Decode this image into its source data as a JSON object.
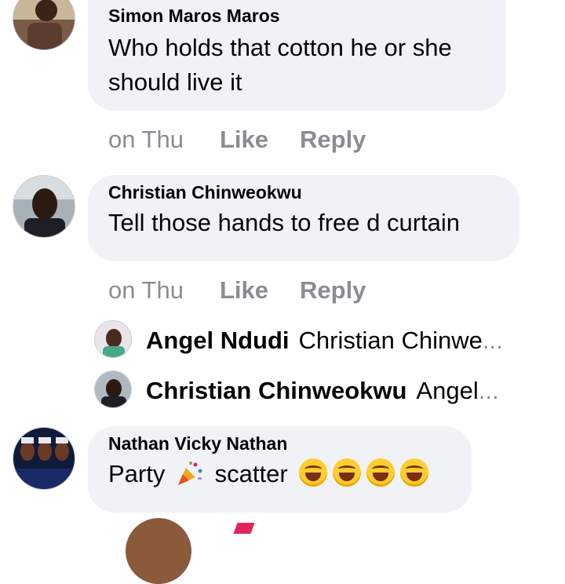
{
  "comments": [
    {
      "author": "Simon Maros Maros",
      "text_line1": "Who holds that cotton he or she",
      "text_line2": "should live it",
      "time": "on Thu",
      "like": "Like",
      "reply": "Reply"
    },
    {
      "author": "Christian Chinweokwu",
      "text": "Tell those hands to free d curtain",
      "time": "on Thu",
      "like": "Like",
      "reply": "Reply",
      "replies": [
        {
          "author": "Angel Ndudi",
          "text": "Christian Chinwe",
          "ellipsis": "..."
        },
        {
          "author": "Christian Chinweokwu",
          "text": "Angel",
          "ellipsis": "..."
        }
      ]
    },
    {
      "author": "Nathan Vicky Nathan",
      "text_before": "Party",
      "text_after": "scatter",
      "emoji": "party-popper",
      "reactions": "face-with-tears-of-joy x4"
    }
  ]
}
